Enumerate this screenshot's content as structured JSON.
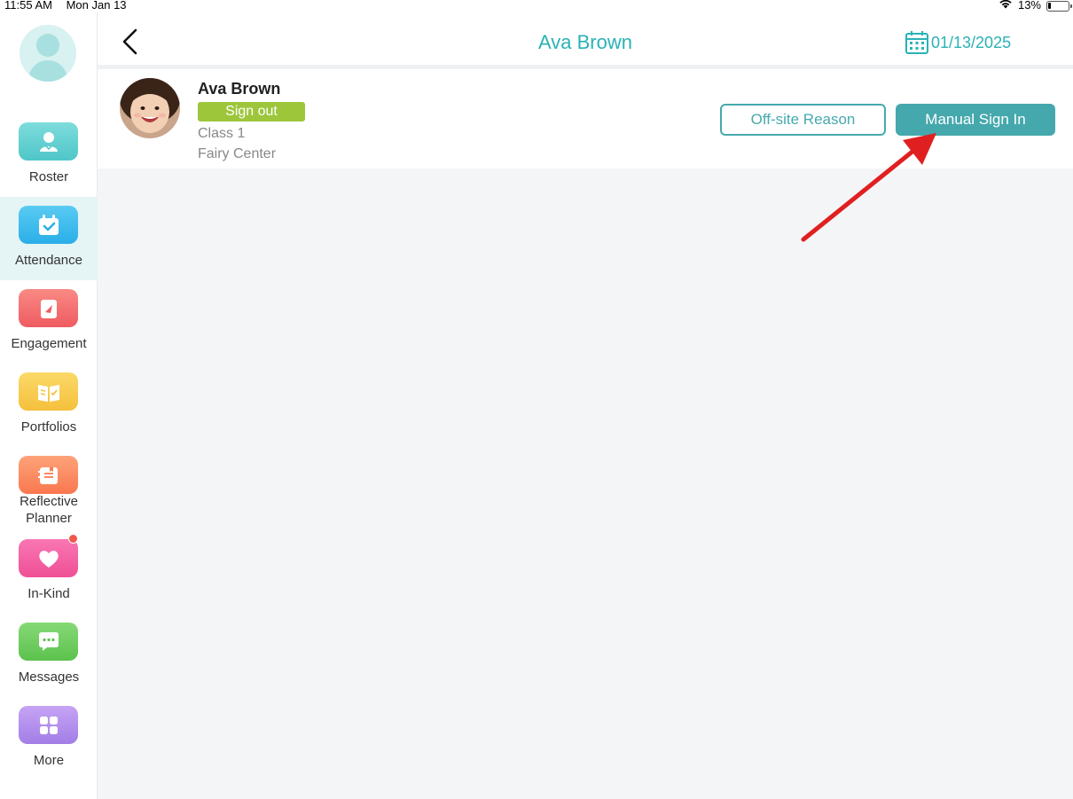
{
  "status_bar": {
    "time": "11:55 AM",
    "date": "Mon Jan 13",
    "battery": "13%"
  },
  "sidebar": {
    "items": [
      {
        "label": "Roster",
        "icon": "roster-icon",
        "color": "#5ccfd0"
      },
      {
        "label": "Attendance",
        "icon": "calendar-check-icon",
        "color": "#38b9ef",
        "active": true
      },
      {
        "label": "Engagement",
        "icon": "engagement-icon",
        "color": "#f26b6b"
      },
      {
        "label": "Portfolios",
        "icon": "portfolio-book-icon",
        "color": "#f7c84a"
      },
      {
        "label": "Reflective\nPlanner",
        "label_line1": "Reflective",
        "label_line2": "Planner",
        "icon": "planner-icon",
        "color": "#fb8a5e"
      },
      {
        "label": "In-Kind",
        "icon": "heart-icon",
        "color": "#f45fa3",
        "notification": true
      },
      {
        "label": "Messages",
        "icon": "chat-icon",
        "color": "#6ccf5e"
      },
      {
        "label": "More",
        "icon": "grid-icon",
        "color": "#b28bec"
      }
    ]
  },
  "header": {
    "title": "Ava Brown",
    "date": "01/13/2025"
  },
  "student": {
    "name": "Ava Brown",
    "status": "Sign out",
    "class": "Class 1",
    "center": "Fairy Center"
  },
  "actions": {
    "offsite_label": "Off-site Reason",
    "manual_signin_label": "Manual Sign In"
  },
  "colors": {
    "accent": "#2ab2b6",
    "button": "#45a8ad",
    "status_green": "#9dc63b",
    "annotation_arrow": "#e02020"
  }
}
